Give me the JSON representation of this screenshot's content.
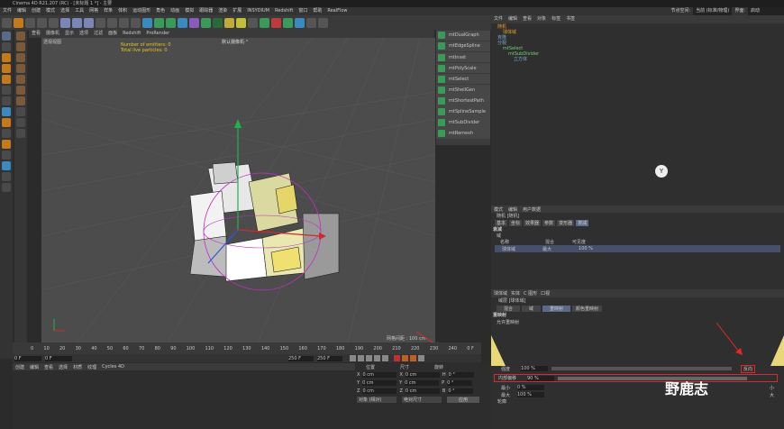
{
  "window_title": "Cinema 4D R21.207 (RC) - [未标题 1 *] - 主要",
  "menu": [
    "文件",
    "编辑",
    "创建",
    "模式",
    "选择",
    "工具",
    "网格",
    "样条",
    "体积",
    "运动图形",
    "角色",
    "动画",
    "模拟",
    "跟踪器",
    "渲染",
    "扩展",
    "INSYDIUM",
    "Redshift",
    "窗口",
    "帮助",
    "RealFlow"
  ],
  "node_space_label": "节点空间:",
  "node_space_value": "当前 (标准/物理)",
  "interface_label": "界面:",
  "interface_value": "启动",
  "viewport_menu": [
    "查看",
    "摄像机",
    "显示",
    "选项",
    "过滤",
    "面板",
    "Redshift",
    "ProRender"
  ],
  "viewport_name": "透视视图",
  "camera_label": "默认摄像机·°",
  "info": {
    "emitters": "Number of emitters: 0",
    "particles": "Total live particles: 0"
  },
  "grid_label": "网格间距 : 100 cm",
  "plugins": [
    {
      "label": "mtDualGraph",
      "color": "#3a9a5a"
    },
    {
      "label": "mtEdgeSpline",
      "color": "#3a9a5a"
    },
    {
      "label": "mtInset",
      "color": "#3a9a5a"
    },
    {
      "label": "mtPolyScale",
      "color": "#3a9a5a"
    },
    {
      "label": "mtSelect",
      "color": "#3a9a5a"
    },
    {
      "label": "mtShellGen",
      "color": "#3a9a5a"
    },
    {
      "label": "mtShortestPath",
      "color": "#3a9a5a"
    },
    {
      "label": "mtSplineSample",
      "color": "#3a9a5a"
    },
    {
      "label": "mtSubDivider",
      "color": "#3a9a5a"
    },
    {
      "label": "mtRemesh",
      "color": "#3a9a5a"
    }
  ],
  "obj_menu": [
    "文件",
    "编辑",
    "查看",
    "对象",
    "标签",
    "书签"
  ],
  "objects": [
    {
      "label": "随机",
      "indent": 0,
      "color": "#e8a020"
    },
    {
      "label": "球体域",
      "indent": 1,
      "color": "#e8a020"
    },
    {
      "label": "克隆",
      "indent": 0,
      "color": "#7ac"
    },
    {
      "label": "分裂",
      "indent": 0,
      "color": "#7ac"
    },
    {
      "label": "mtSelect",
      "indent": 1,
      "color": "#7c7"
    },
    {
      "label": "mtSubDivider",
      "indent": 2,
      "color": "#7c7"
    },
    {
      "label": "立方体",
      "indent": 3,
      "color": "#7ac"
    }
  ],
  "attr_menu": [
    "模式",
    "编辑",
    "用户数据"
  ],
  "attr_obj": "随机 [随机]",
  "attr_tabs": [
    "基本",
    "坐标",
    "效果器",
    "参数",
    "变形器",
    "衰减"
  ],
  "attr_section": "衰减",
  "attr_domain": "域",
  "domain_cols": [
    "名称",
    "混合",
    "可见度"
  ],
  "domain_row": {
    "name": "球体域",
    "blend": "最大",
    "vis": "100 %"
  },
  "sub_obj_tabs": [
    "球体域",
    "实体",
    "C 图形",
    "口视"
  ],
  "sub_obj": "域层 [球体域]",
  "sub_tabs": [
    "混合",
    "域",
    "重映射",
    "颜色重映射"
  ],
  "remap_title": "重映射",
  "remap_enable": "允许重映射",
  "strength_label": "强度",
  "strength_val": "100 %",
  "invert_label": "反向",
  "inner_label": "内部偏移",
  "inner_val": "90 %",
  "min_label": "最小",
  "min_val": "0 %",
  "max_label": "最大",
  "max_val": "100 %",
  "bottom_clamp": "小",
  "clamp_big": "大",
  "contour": "轮廓",
  "timeline_ticks": [
    "0",
    "10",
    "20",
    "30",
    "40",
    "50",
    "60",
    "70",
    "80",
    "90",
    "100",
    "110",
    "120",
    "130",
    "140",
    "150",
    "160",
    "170",
    "180",
    "190",
    "200",
    "210",
    "220",
    "230",
    "240"
  ],
  "frame_current": "0 F",
  "frame_start": "0 F",
  "frame_end": "250 F",
  "frame_end2": "250 F",
  "frame_right": "0 F",
  "material_menu": [
    "创建",
    "编辑",
    "查看",
    "选择",
    "材质",
    "纹理",
    "Cycles 4D"
  ],
  "coord_headers": [
    "位置",
    "尺寸",
    "旋转"
  ],
  "coords": [
    {
      "axis": "X",
      "pos": "0 cm",
      "size_axis": "X",
      "size": "0 cm",
      "rot_axis": "H",
      "rot": "0 °"
    },
    {
      "axis": "Y",
      "pos": "0 cm",
      "size_axis": "Y",
      "size": "0 cm",
      "rot_axis": "P",
      "rot": "0 °"
    },
    {
      "axis": "Z",
      "pos": "0 cm",
      "size_axis": "Z",
      "size": "0 cm",
      "rot_axis": "B",
      "rot": "0 °"
    }
  ],
  "coord_mode": "对象 (相对)",
  "size_mode": "绝对尺寸",
  "apply_label": "应用",
  "watermark": "野鹿志",
  "colors": {
    "accent": "#e0a030",
    "red": "#e02828",
    "viewport": "#4c4c4c",
    "yellow": "#e6c31e"
  }
}
